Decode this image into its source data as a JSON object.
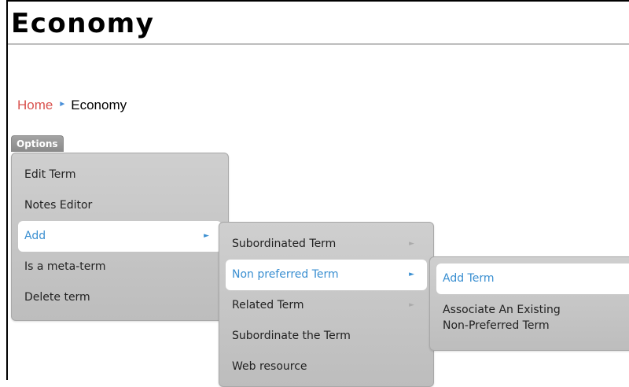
{
  "page": {
    "title": "Economy"
  },
  "breadcrumb": {
    "home": "Home",
    "separator": "►",
    "current": "Economy"
  },
  "options_tab": {
    "label": "Options"
  },
  "menu_options": {
    "items": [
      {
        "label": "Edit Term"
      },
      {
        "label": "Notes Editor"
      },
      {
        "label": "Add",
        "arrow": "►"
      },
      {
        "label": "Is a meta-term"
      },
      {
        "label": "Delete term"
      }
    ]
  },
  "menu_add": {
    "items": [
      {
        "label": "Subordinated Term",
        "arrow": "►"
      },
      {
        "label": "Non preferred Term",
        "arrow": "►"
      },
      {
        "label": "Related Term",
        "arrow": "►"
      },
      {
        "label": "Subordinate the Term"
      },
      {
        "label": "Web resource"
      }
    ]
  },
  "menu_non_preferred": {
    "items": [
      {
        "label": "Add Term"
      },
      {
        "label_line1": "Associate An Existing",
        "label_line2": "Non-Preferred Term"
      }
    ]
  },
  "colors": {
    "home_link": "#d9534f",
    "accent": "#3a8fd1",
    "menu_bg": "#c7c7c7"
  }
}
